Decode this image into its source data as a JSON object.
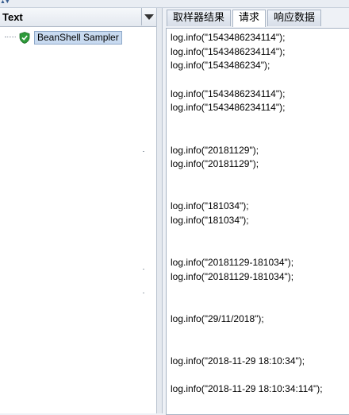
{
  "left_panel": {
    "header_title": "Text",
    "tree_items": [
      {
        "label": "BeanShell Sampler"
      }
    ]
  },
  "tabs": [
    {
      "label": "取样器结果"
    },
    {
      "label": "请求"
    },
    {
      "label": "响应数据"
    }
  ],
  "active_tab": "请求",
  "request_text": [
    "log.info(\"1543486234114\");",
    "log.info(\"1543486234114\");",
    "log.info(\"1543486234\");",
    "",
    "log.info(\"1543486234114\");",
    "log.info(\"1543486234114\");",
    "",
    "",
    "log.info(\"20181129\");",
    "log.info(\"20181129\");",
    "",
    "",
    "log.info(\"181034\");",
    "log.info(\"181034\");",
    "",
    "",
    "log.info(\"20181129-181034\");",
    "log.info(\"20181129-181034\");",
    "",
    "",
    "log.info(\"29/11/2018\");",
    "",
    "",
    "log.info(\"2018-11-29 18:10:34\");",
    "",
    "log.info(\"2018-11-29 18:10:34:114\");"
  ]
}
